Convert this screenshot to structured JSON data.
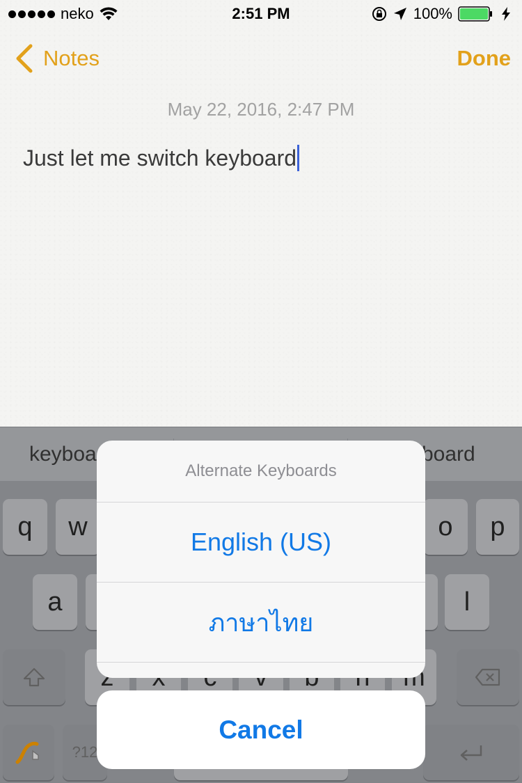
{
  "status_bar": {
    "carrier": "neko",
    "signal_bars": 5,
    "time": "2:51 PM",
    "battery_percent": "100%",
    "battery_color": "#4cd964",
    "icons": [
      "signal-dots-icon",
      "wifi-icon",
      "orientation-lock-icon",
      "location-arrow-icon",
      "battery-icon",
      "charging-bolt-icon"
    ]
  },
  "nav": {
    "back_label": "Notes",
    "done_label": "Done",
    "accent_color": "#e2a11b"
  },
  "note": {
    "date": "May 22, 2016, 2:47 PM",
    "text": "Just let me switch keyboard"
  },
  "keyboard": {
    "predictions": [
      "keyboa",
      "board"
    ],
    "row1": [
      "q",
      "w",
      "o",
      "p"
    ],
    "row2": [
      "a",
      "l"
    ],
    "row3": [
      "z",
      "x",
      "c",
      "v",
      "b",
      "n",
      "m"
    ],
    "mode_key": "?12",
    "icons": [
      "swype-icon",
      "shift-icon",
      "delete-icon",
      "return-icon"
    ]
  },
  "action_sheet": {
    "title": "Alternate Keyboards",
    "options": [
      "English (US)",
      "ภาษาไทย"
    ],
    "cancel_label": "Cancel",
    "tint_color": "#1179e6"
  }
}
